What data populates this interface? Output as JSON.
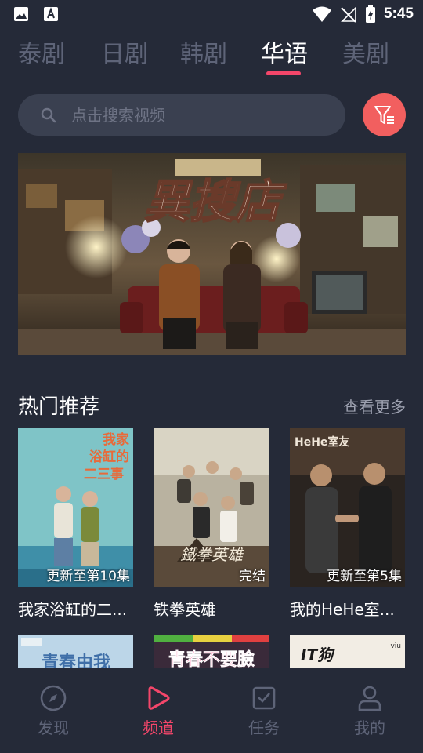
{
  "status_bar": {
    "time": "5:45"
  },
  "tabs": [
    {
      "label": "泰剧",
      "active": false
    },
    {
      "label": "日剧",
      "active": false
    },
    {
      "label": "韩剧",
      "active": false
    },
    {
      "label": "华语",
      "active": true
    },
    {
      "label": "美剧",
      "active": false
    }
  ],
  "search": {
    "placeholder": "点击搜索视频"
  },
  "banner": {
    "title_art": "異搜店"
  },
  "hot": {
    "title": "热门推荐",
    "more": "查看更多",
    "cards": [
      {
        "title": "我家浴缸的二...",
        "badge": "更新至第10集",
        "poster_text": "我家浴缸的二三事"
      },
      {
        "title": "铁拳英雄",
        "badge": "完结",
        "poster_text": "铁拳英雄"
      },
      {
        "title": "我的HeHe室...",
        "badge": "更新至第5集",
        "poster_text": "HeHe室友"
      }
    ],
    "row2": [
      {
        "poster_text": "青春由我"
      },
      {
        "poster_text": "青春不要臉"
      },
      {
        "poster_text": "IT狗"
      }
    ]
  },
  "bottom_nav": [
    {
      "label": "发现",
      "icon": "compass-icon",
      "active": false
    },
    {
      "label": "频道",
      "icon": "play-icon",
      "active": true
    },
    {
      "label": "任务",
      "icon": "task-icon",
      "active": false
    },
    {
      "label": "我的",
      "icon": "user-icon",
      "active": false
    }
  ],
  "colors": {
    "accent": "#f4466a",
    "background": "#252a38",
    "filter": "#f25f5f"
  }
}
